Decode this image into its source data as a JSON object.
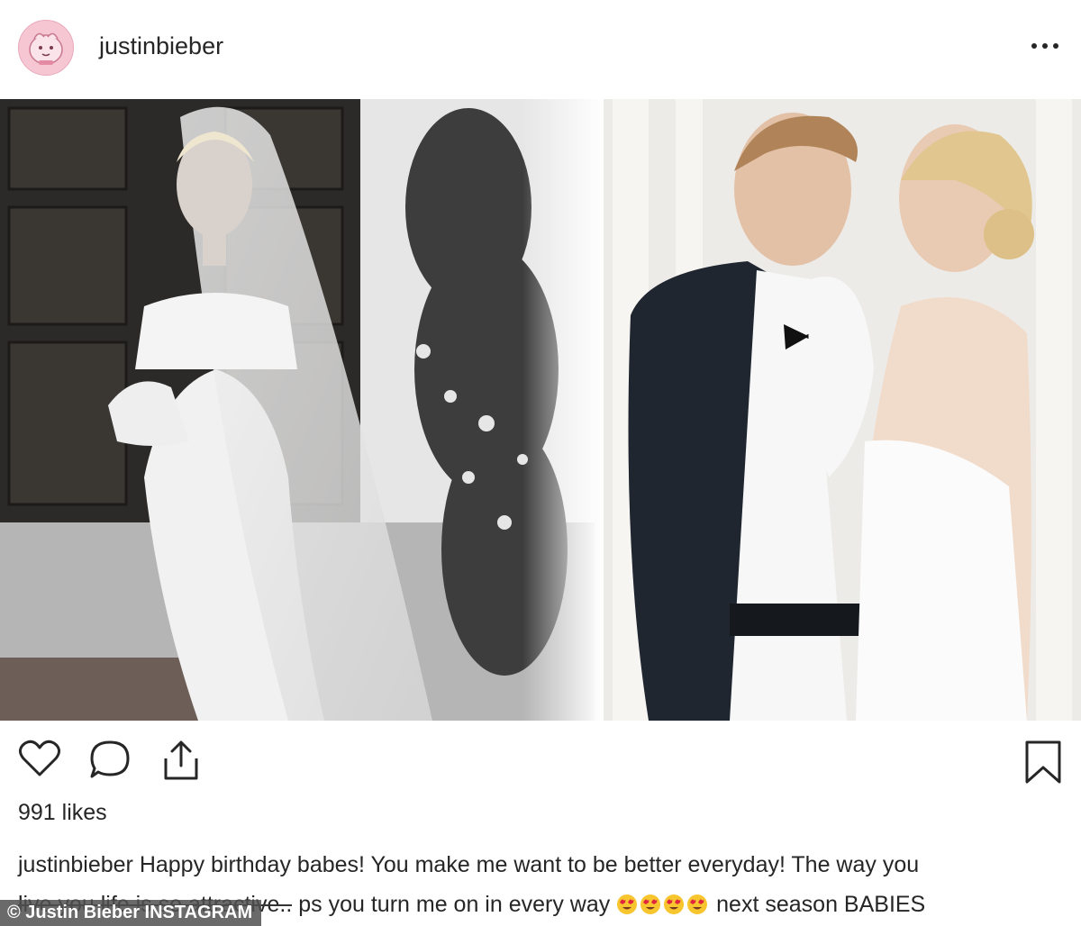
{
  "post": {
    "username": "justinbieber",
    "likes_text": "991 likes",
    "caption": {
      "username": "justinbieber",
      "line1": "Happy birthday babes! You make me want to be better everyday! The way you",
      "line2_struck": "live you life is so attractive..",
      "line2_rest": "ps you turn me on in every way",
      "line2_end": "next season BABIES",
      "emoji_count": 4
    }
  },
  "icons": {
    "more": "more-options-icon",
    "like": "heart-icon",
    "comment": "comment-icon",
    "share": "share-icon",
    "save": "bookmark-icon"
  },
  "photo_alt": "wedding-photo",
  "watermark": "© Justin Bieber INSTAGRAM",
  "colors": {
    "text": "#262626",
    "avatar_bg": "#f6c6d3"
  }
}
